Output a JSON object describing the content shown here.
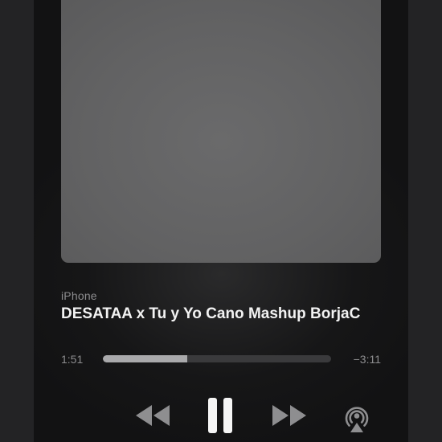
{
  "source": {
    "device_name": "iPhone"
  },
  "now_playing": {
    "title": "DESATAA x Tu y Yo Cano Mashup BorjaC"
  },
  "playback": {
    "elapsed": "1:51",
    "remaining": "−3:11",
    "progress_fraction": 0.37,
    "state": "playing"
  },
  "controls": {
    "rewind_icon": "rewind-icon",
    "pause_icon": "pause-icon",
    "forward_icon": "fast-forward-icon",
    "airplay_icon": "airplay-icon"
  },
  "colors": {
    "progress_fill": "#a9a9ab",
    "progress_track": "#3a3a3c",
    "title": "#f2f2f2",
    "secondary_text": "#8d8d8f"
  }
}
